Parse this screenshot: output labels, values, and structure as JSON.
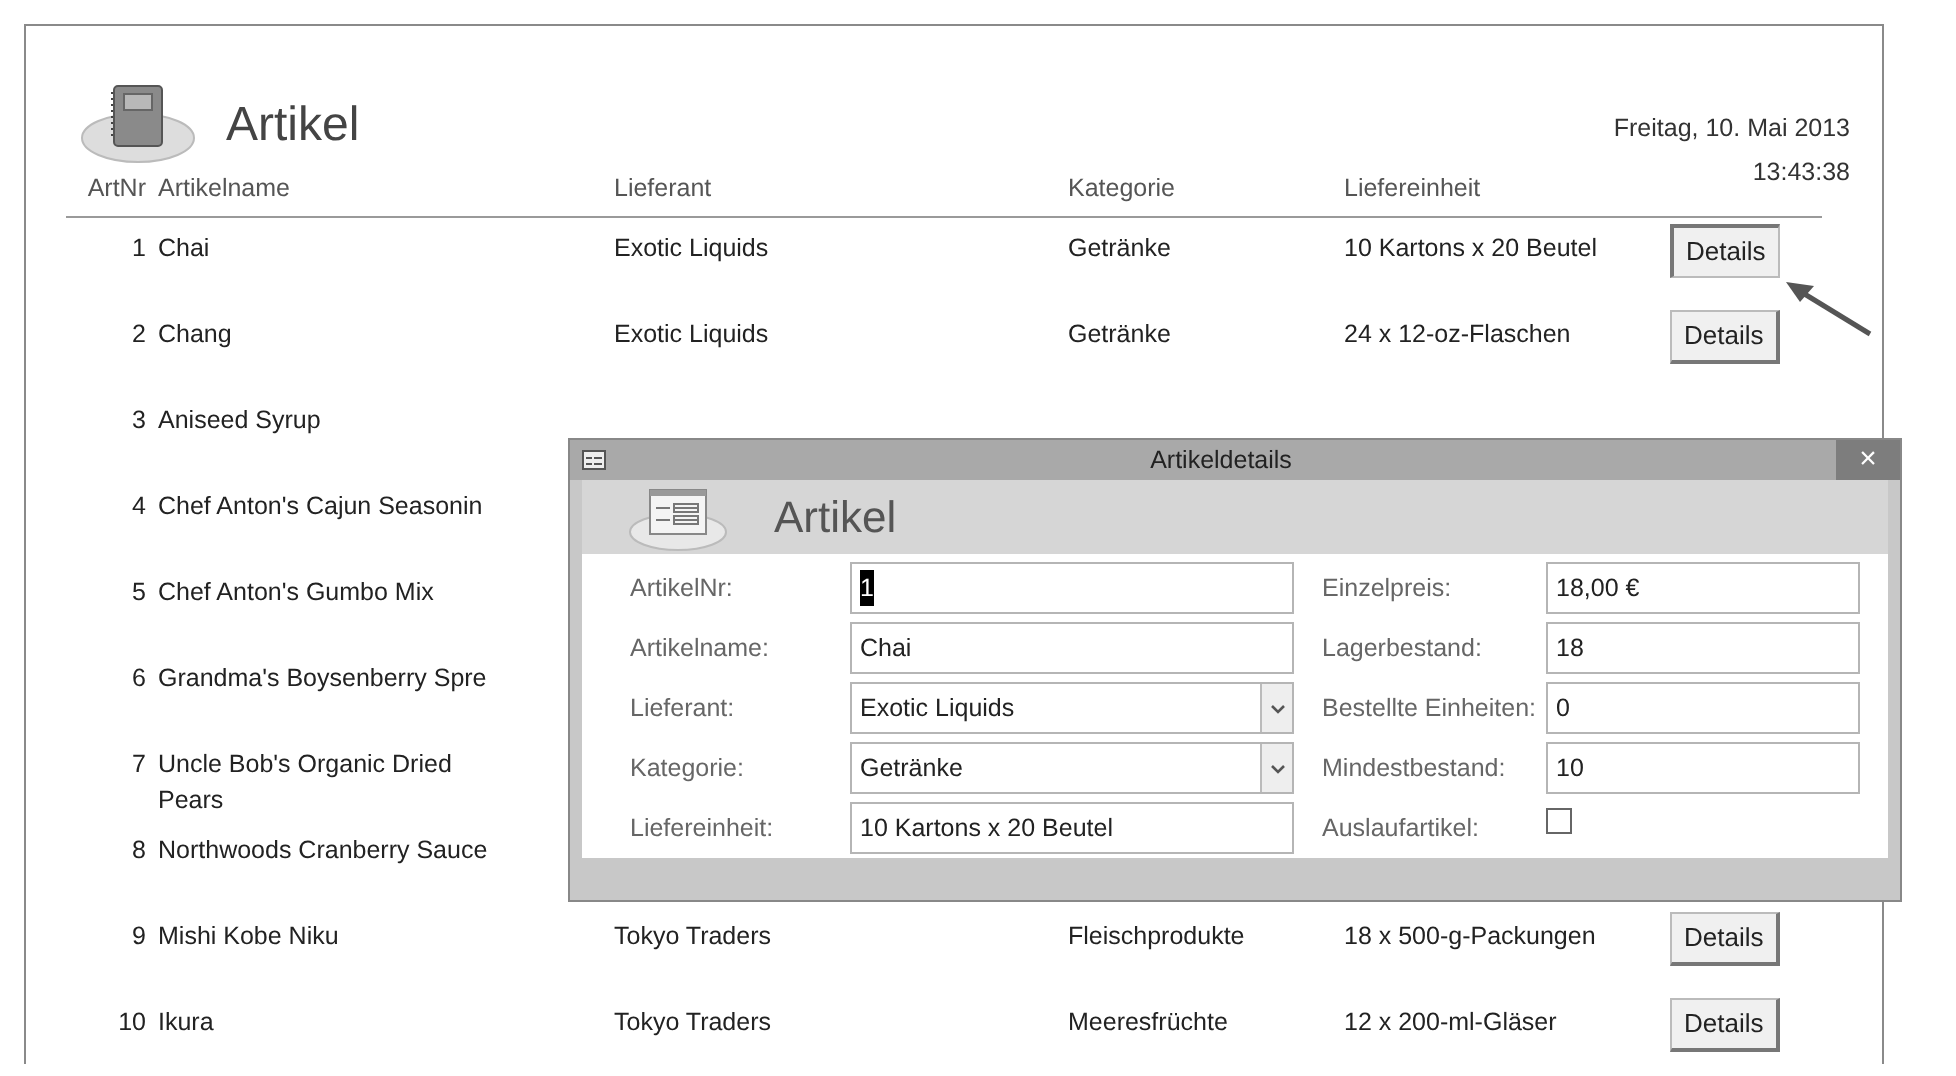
{
  "report": {
    "title": "Artikel",
    "date": "Freitag, 10. Mai 2013",
    "time": "13:43:38",
    "columns": [
      "ArtNr",
      "Artikelname",
      "Lieferant",
      "Kategorie",
      "Liefereinheit"
    ],
    "rows": [
      {
        "nr": "1",
        "name": "Chai",
        "supplier": "Exotic Liquids",
        "category": "Getränke",
        "unit": "10 Kartons x 20 Beutel",
        "button": "Details",
        "pressed": true
      },
      {
        "nr": "2",
        "name": "Chang",
        "supplier": "Exotic Liquids",
        "category": "Getränke",
        "unit": "24 x 12-oz-Flaschen",
        "button": "Details",
        "pressed": false
      },
      {
        "nr": "3",
        "name": "Aniseed Syrup"
      },
      {
        "nr": "4",
        "name": "Chef Anton's Cajun Seasonin"
      },
      {
        "nr": "5",
        "name": "Chef Anton's Gumbo Mix"
      },
      {
        "nr": "6",
        "name": "Grandma's Boysenberry Spre"
      },
      {
        "nr": "7",
        "name": "Uncle Bob's Organic Dried Pears"
      },
      {
        "nr": "8",
        "name": "Northwoods Cranberry Sauce"
      },
      {
        "nr": "9",
        "name": "Mishi Kobe Niku",
        "supplier": "Tokyo Traders",
        "category": "Fleischprodukte",
        "unit": "18 x 500-g-Packungen",
        "button": "Details",
        "pressed": false
      },
      {
        "nr": "10",
        "name": "Ikura",
        "supplier": "Tokyo Traders",
        "category": "Meeresfrüchte",
        "unit": "12 x 200-ml-Gläser",
        "button": "Details",
        "pressed": false
      }
    ]
  },
  "dialog": {
    "title": "Artikeldetails",
    "close": "×",
    "heading": "Artikel",
    "left_fields": [
      {
        "kind": "text",
        "label": "ArtikelNr:",
        "value": "1",
        "highlighted": true
      },
      {
        "kind": "text",
        "label": "Artikelname:",
        "value": "Chai",
        "highlighted": false
      },
      {
        "kind": "combo",
        "label": "Lieferant:",
        "value": "Exotic Liquids",
        "highlighted": false
      },
      {
        "kind": "combo",
        "label": "Kategorie:",
        "value": "Getränke",
        "highlighted": false
      },
      {
        "kind": "text",
        "label": "Liefereinheit:",
        "value": "10 Kartons x 20 Beutel",
        "highlighted": false
      }
    ],
    "right_fields": [
      {
        "kind": "text",
        "label": "Einzelpreis:",
        "value": "18,00 €"
      },
      {
        "kind": "text",
        "label": "Lagerbestand:",
        "value": "18"
      },
      {
        "kind": "text",
        "label": "Bestellte Einheiten:",
        "value": "0"
      },
      {
        "kind": "text",
        "label": "Mindestbestand:",
        "value": "10"
      },
      {
        "kind": "checkbox",
        "label": "Auslaufartikel:",
        "checked": false
      }
    ]
  }
}
